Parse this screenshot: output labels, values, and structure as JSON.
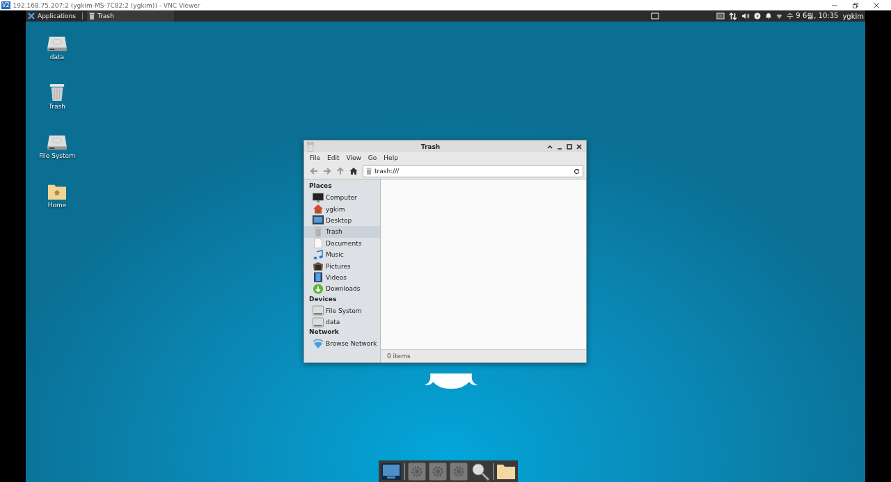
{
  "viewer": {
    "logo": "V2",
    "title": "192.168.75.207:2 (ygkim-MS-7C82:2 (ygkim)) - VNC Viewer"
  },
  "panel": {
    "applications": "Applications",
    "tasks": [
      {
        "label": "Trash",
        "selected": false
      }
    ],
    "clock": "수 9 6월, 10:35",
    "user": "ygkim"
  },
  "desktop_icons": [
    {
      "label": "data"
    },
    {
      "label": "Trash"
    },
    {
      "label": "File System"
    },
    {
      "label": "Home"
    }
  ],
  "window": {
    "title": "Trash",
    "menu": [
      "File",
      "Edit",
      "View",
      "Go",
      "Help"
    ],
    "location": "trash:///",
    "sidebar": [
      {
        "heading": "Places",
        "items": [
          {
            "label": "Computer",
            "selected": false
          },
          {
            "label": "ygkim",
            "selected": false
          },
          {
            "label": "Desktop",
            "selected": false
          },
          {
            "label": "Trash",
            "selected": true
          },
          {
            "label": "Documents",
            "selected": false
          },
          {
            "label": "Music",
            "selected": false
          },
          {
            "label": "Pictures",
            "selected": false
          },
          {
            "label": "Videos",
            "selected": false
          },
          {
            "label": "Downloads",
            "selected": false
          }
        ]
      },
      {
        "heading": "Devices",
        "items": [
          {
            "label": "File System",
            "selected": false
          },
          {
            "label": "data",
            "selected": false
          }
        ]
      },
      {
        "heading": "Network",
        "items": [
          {
            "label": "Browse Network",
            "selected": false
          }
        ]
      }
    ],
    "status": "0 items"
  }
}
